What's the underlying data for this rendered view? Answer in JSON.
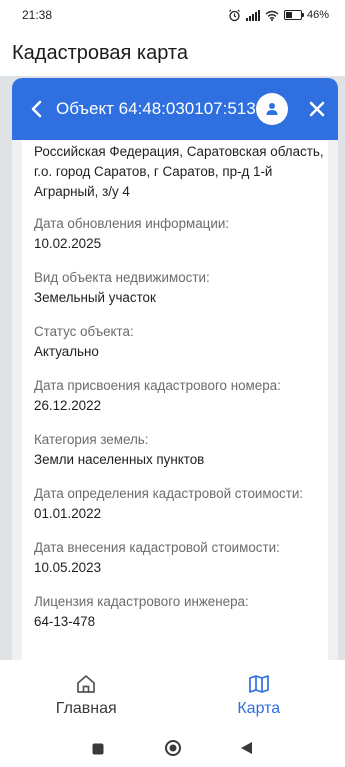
{
  "status_bar": {
    "time": "21:38",
    "battery_text": "46%",
    "battery_level": 0.46
  },
  "app": {
    "title": "Кадастровая карта"
  },
  "panel": {
    "title": "Объект 64:48:030107:513",
    "address": "Российская Федерация, Саратовская область, г.о. город Саратов, г Саратов, пр-д 1-й Аграрный, з/у 4",
    "fields": [
      {
        "label": "Дата обновления информации:",
        "value": "10.02.2025"
      },
      {
        "label": "Вид объекта недвижимости:",
        "value": "Земельный участок"
      },
      {
        "label": "Статус объекта:",
        "value": "Актуально"
      },
      {
        "label": "Дата присвоения кадастрового номера:",
        "value": "26.12.2022"
      },
      {
        "label": "Категория земель:",
        "value": "Земли населенных пунктов"
      },
      {
        "label": "Дата определения кадастровой стоимости:",
        "value": "01.01.2022"
      },
      {
        "label": "Дата внесения кадастровой стоимости:",
        "value": "10.05.2023"
      },
      {
        "label": "Лицензия кадастрового инженера:",
        "value": "64-13-478"
      }
    ]
  },
  "bottom_nav": {
    "items": [
      {
        "label": "Главная",
        "icon": "home-icon",
        "active": false
      },
      {
        "label": "Карта",
        "icon": "map-icon",
        "active": true
      }
    ]
  },
  "colors": {
    "accent": "#2f6fe0",
    "background": "#dfe2e5",
    "label": "#6b6b6b",
    "text": "#1f1f1f"
  }
}
